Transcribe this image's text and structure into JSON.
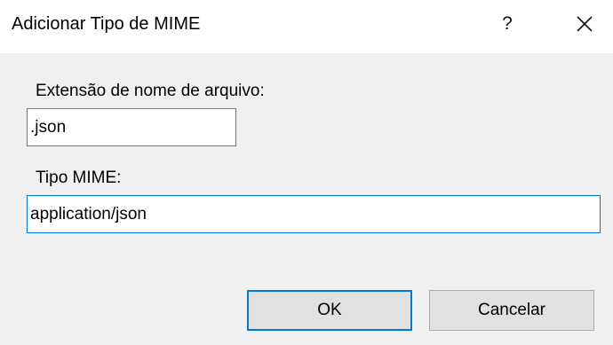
{
  "window": {
    "title": "Adicionar Tipo de MIME",
    "help_label": "?"
  },
  "form": {
    "extension_label": "Extensão de nome de arquivo:",
    "extension_value": ".json",
    "mime_label": "Tipo MIME:",
    "mime_value": "application/json"
  },
  "buttons": {
    "ok_label": "OK",
    "cancel_label": "Cancelar"
  },
  "colors": {
    "focus_border": "#0078d7",
    "titlebar_bg": "#ffffff",
    "dialog_bg": "#f0f0f0",
    "button_bg": "#e1e1e1"
  },
  "icons": {
    "close": "close-icon"
  }
}
